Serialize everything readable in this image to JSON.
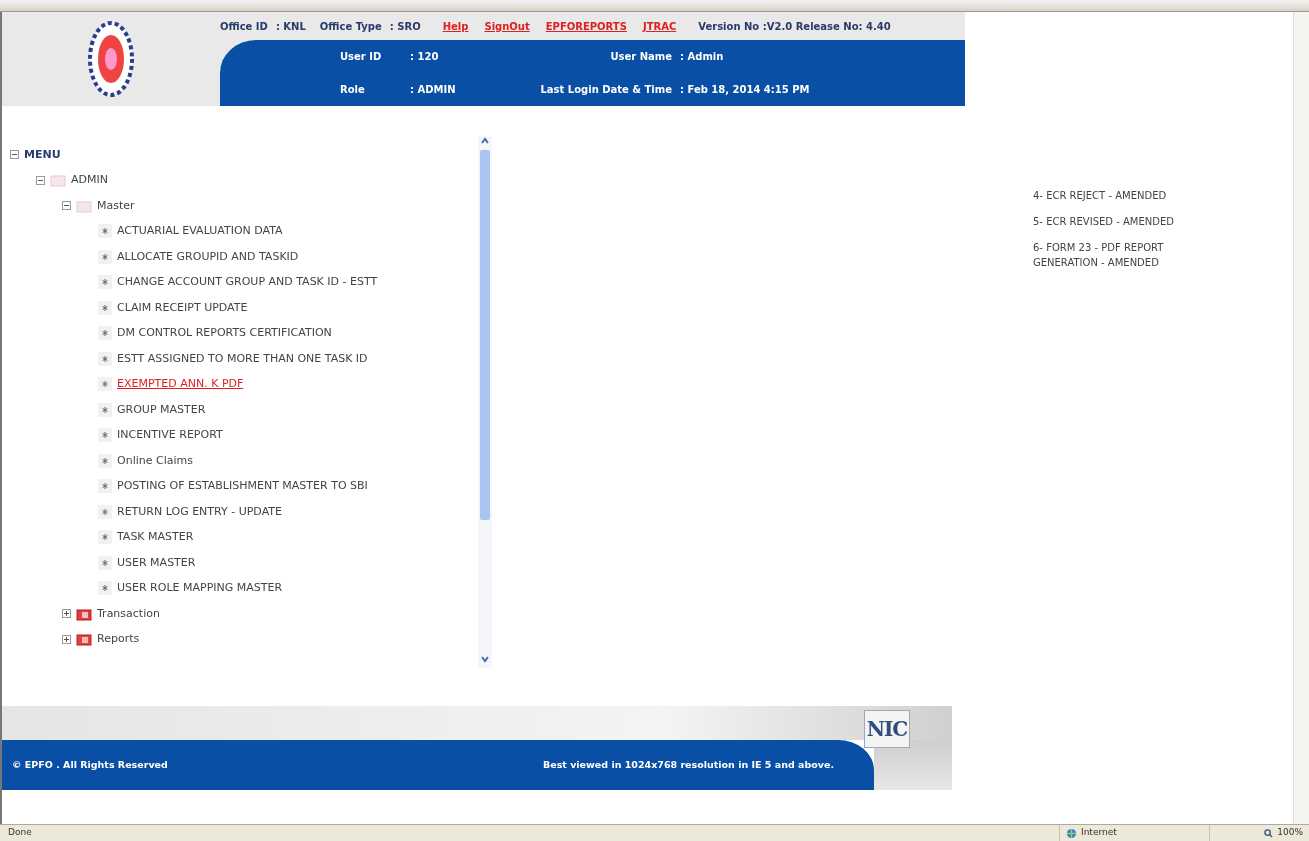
{
  "header": {
    "info": [
      {
        "label": "Office ID",
        "value": ": KNL"
      },
      {
        "label": "Office Type",
        "value": ": SRO"
      }
    ],
    "links": [
      "Help",
      "SignOut",
      "EPFOREPORTS",
      "JTRAC"
    ],
    "version": "Version No :V2.0 Release No: 4.40",
    "user_fields": [
      {
        "label": "User ID",
        "value": ": 120"
      },
      {
        "label": "User Name",
        "value": ": Admin"
      },
      {
        "label": "Role",
        "value": ": ADMIN"
      },
      {
        "label": "Last Login Date & Time",
        "value": ": Feb 18, 2014 4:15 PM"
      }
    ]
  },
  "menu": {
    "label": "MENU",
    "expanded": true,
    "children": [
      {
        "label": "ADMIN",
        "expanded": true,
        "children": [
          {
            "label": "Master",
            "expanded": true,
            "children": [
              {
                "label": "ACTUARIAL EVALUATION DATA",
                "hovered": false
              },
              {
                "label": "ALLOCATE GROUPID AND TASKID",
                "hovered": false
              },
              {
                "label": "CHANGE ACCOUNT GROUP AND TASK ID - ESTT",
                "hovered": false
              },
              {
                "label": "CLAIM RECEIPT UPDATE",
                "hovered": false
              },
              {
                "label": "DM CONTROL REPORTS CERTIFICATION",
                "hovered": false
              },
              {
                "label": "ESTT ASSIGNED TO MORE THAN ONE TASK ID",
                "hovered": false
              },
              {
                "label": "EXEMPTED ANN. K PDF",
                "hovered": true
              },
              {
                "label": "GROUP MASTER",
                "hovered": false
              },
              {
                "label": "INCENTIVE REPORT",
                "hovered": false
              },
              {
                "label": "Online Claims",
                "hovered": false
              },
              {
                "label": "POSTING OF ESTABLISHMENT MASTER TO SBI",
                "hovered": false
              },
              {
                "label": "RETURN LOG ENTRY - UPDATE",
                "hovered": false
              },
              {
                "label": "TASK MASTER",
                "hovered": false
              },
              {
                "label": "USER MASTER",
                "hovered": false
              },
              {
                "label": "USER ROLE MAPPING MASTER",
                "hovered": false
              }
            ]
          },
          {
            "label": "Transaction",
            "expanded": false
          },
          {
            "label": "Reports",
            "expanded": false
          }
        ]
      }
    ]
  },
  "news": [
    "4- ECR REJECT - AMENDED",
    "5- ECR REVISED - AMENDED",
    "6- FORM 23 - PDF REPORT GENERATION - AMENDED"
  ],
  "footer": {
    "copyright": "© EPFO . All Rights Reserved",
    "note": "Best viewed in 1024x768 resolution in IE 5 and above.",
    "logo_text": "NIC"
  },
  "status_bar": {
    "status": "Done",
    "zone": "Internet",
    "zoom": "100%"
  }
}
